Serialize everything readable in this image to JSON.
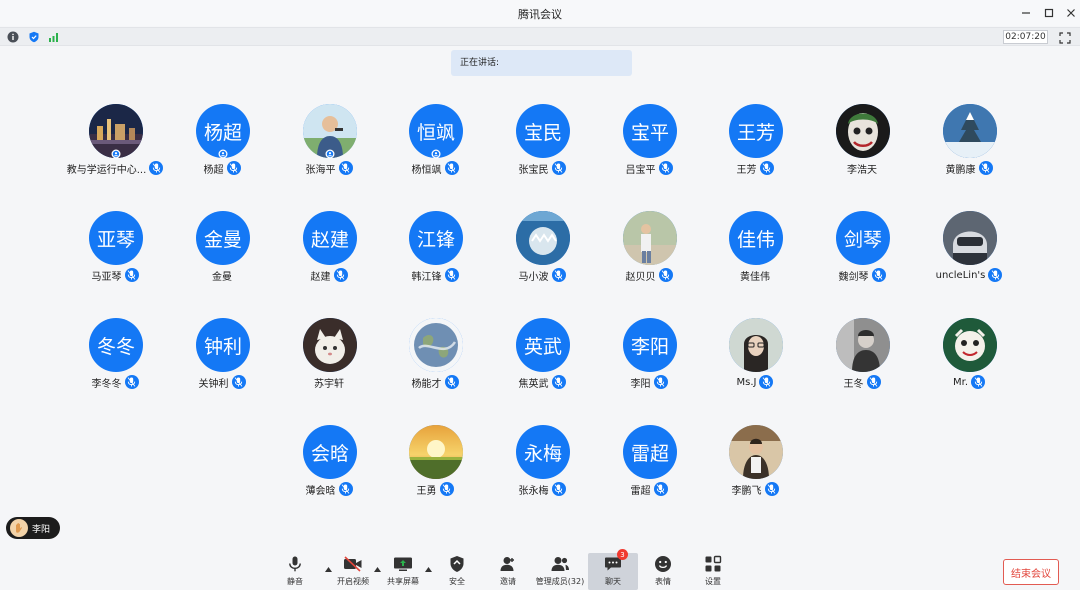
{
  "window": {
    "title": "腾讯会议"
  },
  "status": {
    "timer": "02:07:20"
  },
  "speaking": {
    "label": "正在讲话:"
  },
  "participants": [
    {
      "name": "教与学运行中心...",
      "avatar_text": "",
      "photo": "city-night",
      "mic": true,
      "cohost": true
    },
    {
      "name": "杨超",
      "avatar_text": "杨超",
      "photo": "",
      "mic": true,
      "cohost": true
    },
    {
      "name": "张海平",
      "avatar_text": "",
      "photo": "man-outdoor",
      "mic": true,
      "cohost": true
    },
    {
      "name": "杨恒飒",
      "avatar_text": "恒飒",
      "photo": "",
      "mic": true,
      "cohost": true
    },
    {
      "name": "张宝民",
      "avatar_text": "宝民",
      "photo": "",
      "mic": true,
      "cohost": false
    },
    {
      "name": "吕宝平",
      "avatar_text": "宝平",
      "photo": "",
      "mic": true,
      "cohost": false
    },
    {
      "name": "王芳",
      "avatar_text": "王芳",
      "photo": "",
      "mic": true,
      "cohost": false
    },
    {
      "name": "李浩天",
      "avatar_text": "",
      "photo": "joker",
      "mic": false,
      "cohost": false
    },
    {
      "name": "黄鹏康",
      "avatar_text": "",
      "photo": "snow-tree",
      "mic": true,
      "cohost": false
    },
    {
      "name": "马亚琴",
      "avatar_text": "亚琴",
      "photo": "",
      "mic": true,
      "cohost": false
    },
    {
      "name": "金曼",
      "avatar_text": "金曼",
      "photo": "",
      "mic": false,
      "cohost": false
    },
    {
      "name": "赵建",
      "avatar_text": "赵建",
      "photo": "",
      "mic": true,
      "cohost": false
    },
    {
      "name": "韩江锋",
      "avatar_text": "江锋",
      "photo": "",
      "mic": true,
      "cohost": false
    },
    {
      "name": "马小波",
      "avatar_text": "",
      "photo": "shark",
      "mic": true,
      "cohost": false
    },
    {
      "name": "赵贝贝",
      "avatar_text": "",
      "photo": "person-road",
      "mic": true,
      "cohost": false
    },
    {
      "name": "黄佳伟",
      "avatar_text": "佳伟",
      "photo": "",
      "mic": false,
      "cohost": false
    },
    {
      "name": "魏剑琴",
      "avatar_text": "剑琴",
      "photo": "",
      "mic": true,
      "cohost": false
    },
    {
      "name": "uncleLin's",
      "avatar_text": "",
      "photo": "helmet",
      "mic": true,
      "cohost": false
    },
    {
      "name": "李冬冬",
      "avatar_text": "冬冬",
      "photo": "",
      "mic": true,
      "cohost": false
    },
    {
      "name": "关钟利",
      "avatar_text": "钟利",
      "photo": "",
      "mic": true,
      "cohost": false
    },
    {
      "name": "苏宇轩",
      "avatar_text": "",
      "photo": "cat",
      "mic": false,
      "cohost": false
    },
    {
      "name": "杨能才",
      "avatar_text": "",
      "photo": "earth",
      "mic": true,
      "cohost": false
    },
    {
      "name": "焦英武",
      "avatar_text": "英武",
      "photo": "",
      "mic": true,
      "cohost": false
    },
    {
      "name": "李阳",
      "avatar_text": "李阳",
      "photo": "",
      "mic": true,
      "cohost": false
    },
    {
      "name": "Ms.J",
      "avatar_text": "",
      "photo": "woman-glasses",
      "mic": true,
      "cohost": false
    },
    {
      "name": "王冬",
      "avatar_text": "",
      "photo": "man-dark",
      "mic": true,
      "cohost": false
    },
    {
      "name": "Mr.",
      "avatar_text": "",
      "photo": "cartoon",
      "mic": true,
      "cohost": false
    },
    {
      "name": "薄会晗",
      "avatar_text": "会晗",
      "photo": "",
      "mic": true,
      "cohost": false
    },
    {
      "name": "王勇",
      "avatar_text": "",
      "photo": "sunset",
      "mic": true,
      "cohost": false
    },
    {
      "name": "张永梅",
      "avatar_text": "永梅",
      "photo": "",
      "mic": true,
      "cohost": false
    },
    {
      "name": "雷超",
      "avatar_text": "雷超",
      "photo": "",
      "mic": true,
      "cohost": false
    },
    {
      "name": "李鹏飞",
      "avatar_text": "",
      "photo": "man-room",
      "mic": true,
      "cohost": false
    }
  ],
  "raised_hand": {
    "name": "李阳"
  },
  "toolbar": {
    "mute": "静音",
    "video": "开启视频",
    "share": "共享屏幕",
    "security": "安全",
    "invite": "邀请",
    "members": "管理成员(32)",
    "chat": "聊天",
    "chat_badge": "3",
    "reactions": "表情",
    "settings": "设置",
    "end": "结束会议"
  },
  "colors": {
    "accent": "#1478f5",
    "danger": "#e2463c",
    "background": "#f5f6f8"
  }
}
